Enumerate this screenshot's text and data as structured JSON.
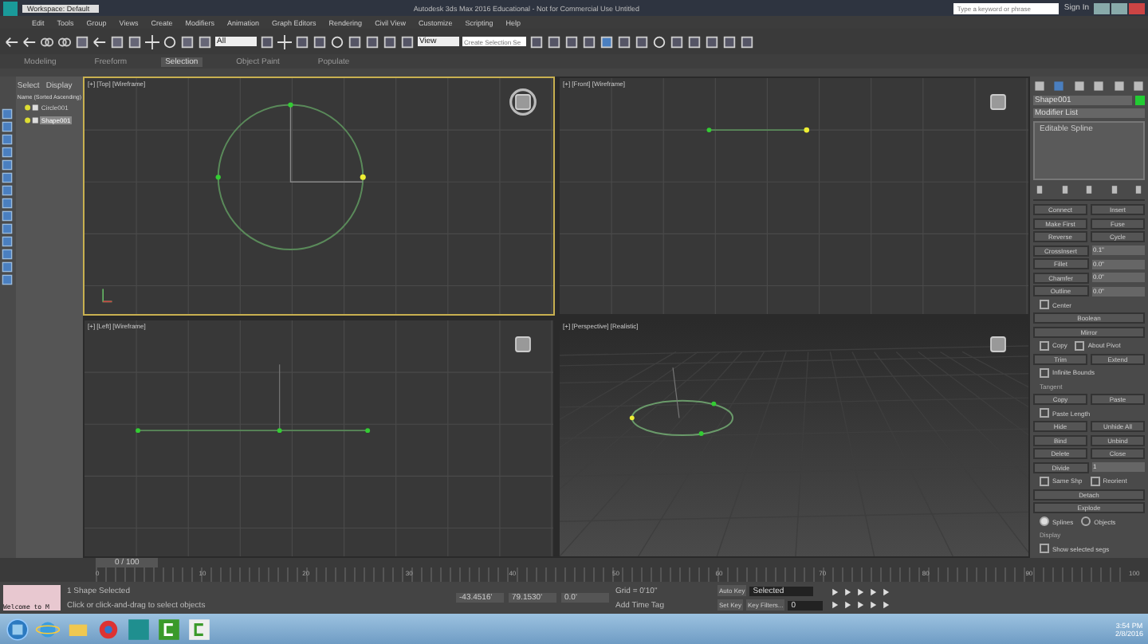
{
  "title_bar": {
    "workspace": "Workspace: Default",
    "title": "Autodesk 3ds Max 2016 Educational - Not for Commercial Use   Untitled",
    "search_placeholder": "Type a keyword or phrase",
    "sign_in": "Sign In"
  },
  "menu": [
    "Edit",
    "Tools",
    "Group",
    "Views",
    "Create",
    "Modifiers",
    "Animation",
    "Graph Editors",
    "Rendering",
    "Civil View",
    "Customize",
    "Scripting",
    "Help"
  ],
  "toolbar": {
    "filter": "All",
    "reference": "View",
    "selection_set_placeholder": "Create Selection Se"
  },
  "ribbon_tabs": [
    {
      "label": "Modeling",
      "selected": false
    },
    {
      "label": "Freeform",
      "selected": false
    },
    {
      "label": "Selection",
      "selected": true
    },
    {
      "label": "Object Paint",
      "selected": false
    },
    {
      "label": "Populate",
      "selected": false
    }
  ],
  "explorer": {
    "tabs": [
      "Select",
      "Display"
    ],
    "header": "Name (Sorted Ascending)",
    "items": [
      {
        "name": "Circle001",
        "selected": false
      },
      {
        "name": "Shape001",
        "selected": true
      }
    ]
  },
  "viewports": [
    {
      "label": "[+] [Top] [Wireframe]",
      "kind": "top",
      "selected": true
    },
    {
      "label": "[+] [Front] [Wireframe]",
      "kind": "front",
      "selected": false
    },
    {
      "label": "[+] [Left] [Wireframe]",
      "kind": "left",
      "selected": false
    },
    {
      "label": "[+] [Perspective] [Realistic]",
      "kind": "perspective",
      "selected": false
    }
  ],
  "command_panel": {
    "object_name": "Shape001",
    "color": "#22cc33",
    "modifier_list": "Modifier List",
    "stack": [
      {
        "name": "Editable Spline",
        "selected": false
      }
    ],
    "rows": [
      {
        "kind": "pair",
        "labels": [
          "Connect",
          "Insert"
        ]
      },
      {
        "kind": "pair",
        "labels": [
          "Make First",
          "Fuse"
        ]
      },
      {
        "kind": "pair",
        "labels": [
          "Reverse",
          "Cycle"
        ]
      },
      {
        "kind": "spin",
        "label": "CrossInsert",
        "value": "0.1\""
      },
      {
        "kind": "spin",
        "label": "Fillet",
        "value": "0.0\""
      },
      {
        "kind": "spin",
        "label": "Chamfer",
        "value": "0.0\""
      },
      {
        "kind": "spin",
        "label": "Outline",
        "value": "0.0\""
      },
      {
        "kind": "check",
        "label": "Center",
        "checked": false
      },
      {
        "kind": "pair",
        "labels": [
          "Boolean"
        ]
      },
      {
        "kind": "pair",
        "labels": [
          "Mirror"
        ]
      },
      {
        "kind": "checks",
        "items": [
          {
            "label": "Copy",
            "checked": false
          },
          {
            "label": "About Pivot",
            "checked": false
          }
        ]
      },
      {
        "kind": "pair",
        "labels": [
          "Trim",
          "Extend"
        ]
      },
      {
        "kind": "check",
        "label": "Infinite Bounds",
        "checked": false
      },
      {
        "kind": "group",
        "label": "Tangent"
      },
      {
        "kind": "pair",
        "labels": [
          "Copy",
          "Paste"
        ]
      },
      {
        "kind": "check",
        "label": "Paste Length",
        "checked": false
      },
      {
        "kind": "pair",
        "labels": [
          "Hide",
          "Unhide All"
        ]
      },
      {
        "kind": "pair",
        "labels": [
          "Bind",
          "Unbind"
        ]
      },
      {
        "kind": "pair",
        "labels": [
          "Delete",
          "Close"
        ]
      },
      {
        "kind": "spin",
        "label": "Divide",
        "value": "1"
      },
      {
        "kind": "checks",
        "items": [
          {
            "label": "Same Shp",
            "checked": false
          },
          {
            "label": "Reorient",
            "checked": false
          }
        ]
      },
      {
        "kind": "pair",
        "labels": [
          "Detach"
        ]
      },
      {
        "kind": "pair",
        "labels": [
          "Explode"
        ]
      },
      {
        "kind": "radio",
        "options": [
          {
            "label": "Splines",
            "selected": true
          },
          {
            "label": "Objects",
            "selected": false
          }
        ]
      },
      {
        "kind": "group",
        "label": "Display"
      },
      {
        "kind": "check",
        "label": "Show selected segs",
        "checked": false
      }
    ]
  },
  "timeline": {
    "position": "0 / 100",
    "level": 0,
    "ticks": [
      "0",
      "10",
      "20",
      "30",
      "40",
      "50",
      "60",
      "70",
      "80",
      "90",
      "100"
    ]
  },
  "status": {
    "welcome": "Welcome to M",
    "selection": "1 Shape Selected",
    "prompt": "Click or click-and-drag to select objects",
    "x": "-43.4516'",
    "y": "79.1530'",
    "z": "0.0'",
    "grid": "Grid = 0'10\"",
    "time_tag": "Add Time Tag",
    "auto_key": "Auto Key",
    "key_mode": "Selected",
    "set_key": "Set Key",
    "key_filters": "Key Filters...",
    "frame": "0"
  },
  "taskbar": {
    "time": "3:54 PM",
    "date": "2/8/2016"
  }
}
